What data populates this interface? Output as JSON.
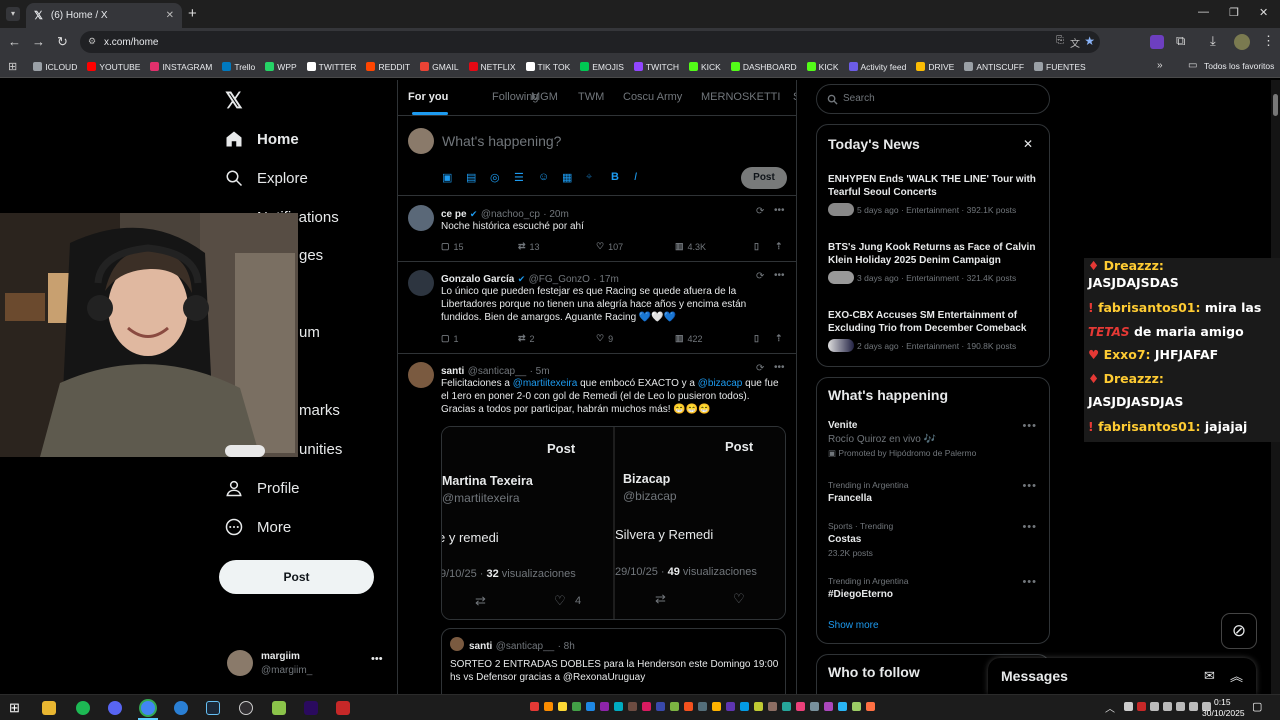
{
  "browser": {
    "tab_title": "(6) Home / X",
    "url": "x.com/home",
    "bookmarks": [
      {
        "label": "ICLOUD",
        "color": "#9aa0a6"
      },
      {
        "label": "YOUTUBE",
        "color": "#ff0000"
      },
      {
        "label": "INSTAGRAM",
        "color": "#e1306c"
      },
      {
        "label": "Trello",
        "color": "#0079bf"
      },
      {
        "label": "WPP",
        "color": "#25d366"
      },
      {
        "label": "TWITTER",
        "color": "#ffffff"
      },
      {
        "label": "REDDIT",
        "color": "#ff4500"
      },
      {
        "label": "GMAIL",
        "color": "#ea4335"
      },
      {
        "label": "NETFLIX",
        "color": "#e50914"
      },
      {
        "label": "TIK TOK",
        "color": "#ffffff"
      },
      {
        "label": "EMOJIS",
        "color": "#00c853"
      },
      {
        "label": "TWITCH",
        "color": "#9146ff"
      },
      {
        "label": "KICK",
        "color": "#53fc18"
      },
      {
        "label": "DASHBOARD",
        "color": "#53fc18"
      },
      {
        "label": "KICK",
        "color": "#53fc18"
      },
      {
        "label": "Activity feed",
        "color": "#6c5ce7"
      },
      {
        "label": "DRIVE",
        "color": "#fbbc04"
      },
      {
        "label": "ANTISCUFF",
        "color": "#9aa0a6"
      },
      {
        "label": "FUENTES",
        "color": "#9aa0a6"
      }
    ],
    "all_bookmarks": "Todos los favoritos"
  },
  "nav": {
    "home": "Home",
    "explore": "Explore",
    "notifications": "Notifications",
    "messages_partial": "ges",
    "premium_partial": "um",
    "bookmarks_partial": "marks",
    "communities_partial": "unities",
    "profile": "Profile",
    "more": "More",
    "post_button": "Post",
    "account_name": "margiim",
    "account_handle": "@margiim_"
  },
  "feed": {
    "tabs": [
      "For you",
      "Following",
      "MGM",
      "TWM",
      "Coscu Army",
      "MERNOSKETTI",
      "S"
    ],
    "compose_placeholder": "What's happening?",
    "compose_post": "Post",
    "tweets": [
      {
        "name": "ce pe",
        "handle": "@nachoo_cp",
        "time": "· 20m",
        "text": "Noche histórica escuché por ahí",
        "replies": "15",
        "retweets": "13",
        "likes": "107",
        "views": "4.3K"
      },
      {
        "name": "Gonzalo García",
        "handle": "@FG_GonzO",
        "time": "· 17m",
        "text": "Lo único que pueden festejar es que Racing se quede afuera de la Libertadores porque no tienen una alegría hace años y encima están fundidos. Bien de amargos. Aguante Racing 💙🤍💙",
        "replies": "1",
        "retweets": "2",
        "likes": "9",
        "views": "422"
      },
      {
        "name": "santi",
        "handle": "@santicap__",
        "time": "· 5m",
        "text_parts": [
          "Felicitaciones a ",
          "@martiitexeira",
          " que embocó EXACTO y a ",
          "@bizacap",
          " que fue el 1ero en poner 2-0 con gol de Remedi (el de Leo lo pusieron todos). Gracias a todos por participar, habrán muchos más! 😁😁😁"
        ],
        "images": [
          {
            "header": "Post",
            "name": "Martina Texeira",
            "handle": "@martiitexeira",
            "text": "e y remedi",
            "date": "9/10/25 · ",
            "views_num": "32",
            "views_label": " visualizaciones",
            "likes": "4"
          },
          {
            "header": "Post",
            "name": "Bizacap",
            "handle": "@bizacap",
            "text": "Silvera y Remedi",
            "date": "29/10/25 · ",
            "views_num": "49",
            "views_label": " visualizaciones",
            "likes": ""
          }
        ],
        "quote": {
          "name": "santi",
          "handle": "@santicap__",
          "time": "· 8h",
          "text": "SORTEO 2 ENTRADAS DOBLES para la Henderson este Domingo 19:00 hs vs Defensor gracias a @RexonaUruguay"
        }
      }
    ]
  },
  "sidebar": {
    "search_placeholder": "Search",
    "todays_news_title": "Today's News",
    "news": [
      {
        "headline": "ENHYPEN Ends 'WALK THE LINE' Tour with Tearful Seoul Concerts",
        "meta": "5 days ago · Entertainment · 392.1K posts"
      },
      {
        "headline": "BTS's Jung Kook Returns as Face of Calvin Klein Holiday 2025 Denim Campaign",
        "meta": "3 days ago · Entertainment · 321.4K posts"
      },
      {
        "headline": "EXO-CBX Accuses SM Entertainment of Excluding Trio from December Comeback",
        "meta": "2 days ago · Entertainment · 190.8K posts"
      }
    ],
    "whats_happening_title": "What's happening",
    "promoted": {
      "name": "Venite",
      "text": "Rocío Quiroz en vivo 🎶",
      "label": "Promoted by Hipódromo de Palermo"
    },
    "trends": [
      {
        "context": "Trending in Argentina",
        "name": "Francella",
        "posts": ""
      },
      {
        "context": "Sports · Trending",
        "name": "Costas",
        "posts": "23.2K posts"
      },
      {
        "context": "Trending in Argentina",
        "name": "#DiegoEterno",
        "posts": ""
      }
    ],
    "show_more": "Show more",
    "who_to_follow": "Who to follow",
    "messages": "Messages"
  },
  "chat_overlay": [
    {
      "user": "Dreazzz:",
      "msg": "",
      "color": "#ffcc33"
    },
    {
      "user": "",
      "msg": "JASJDAJSDAS",
      "color": "#ffffff"
    },
    {
      "user": "fabrisantos01:",
      "msg": "mira las",
      "color": "#ffcc33"
    },
    {
      "user": "",
      "msg": "de maria amigo",
      "color": "#ffffff"
    },
    {
      "user": "Exxo7:",
      "msg": "JHFJAFAF",
      "color": "#ffcc33"
    },
    {
      "user": "Dreazzz:",
      "msg": "",
      "color": "#ffcc33"
    },
    {
      "user": "",
      "msg": "JASJDJASDJAS",
      "color": "#ffffff"
    },
    {
      "user": "fabrisantos01:",
      "msg": "jajajaj",
      "color": "#ffcc33"
    }
  ],
  "chat_emote": "TETAS",
  "clock": {
    "time": "0:15",
    "date": "30/10/2025"
  }
}
